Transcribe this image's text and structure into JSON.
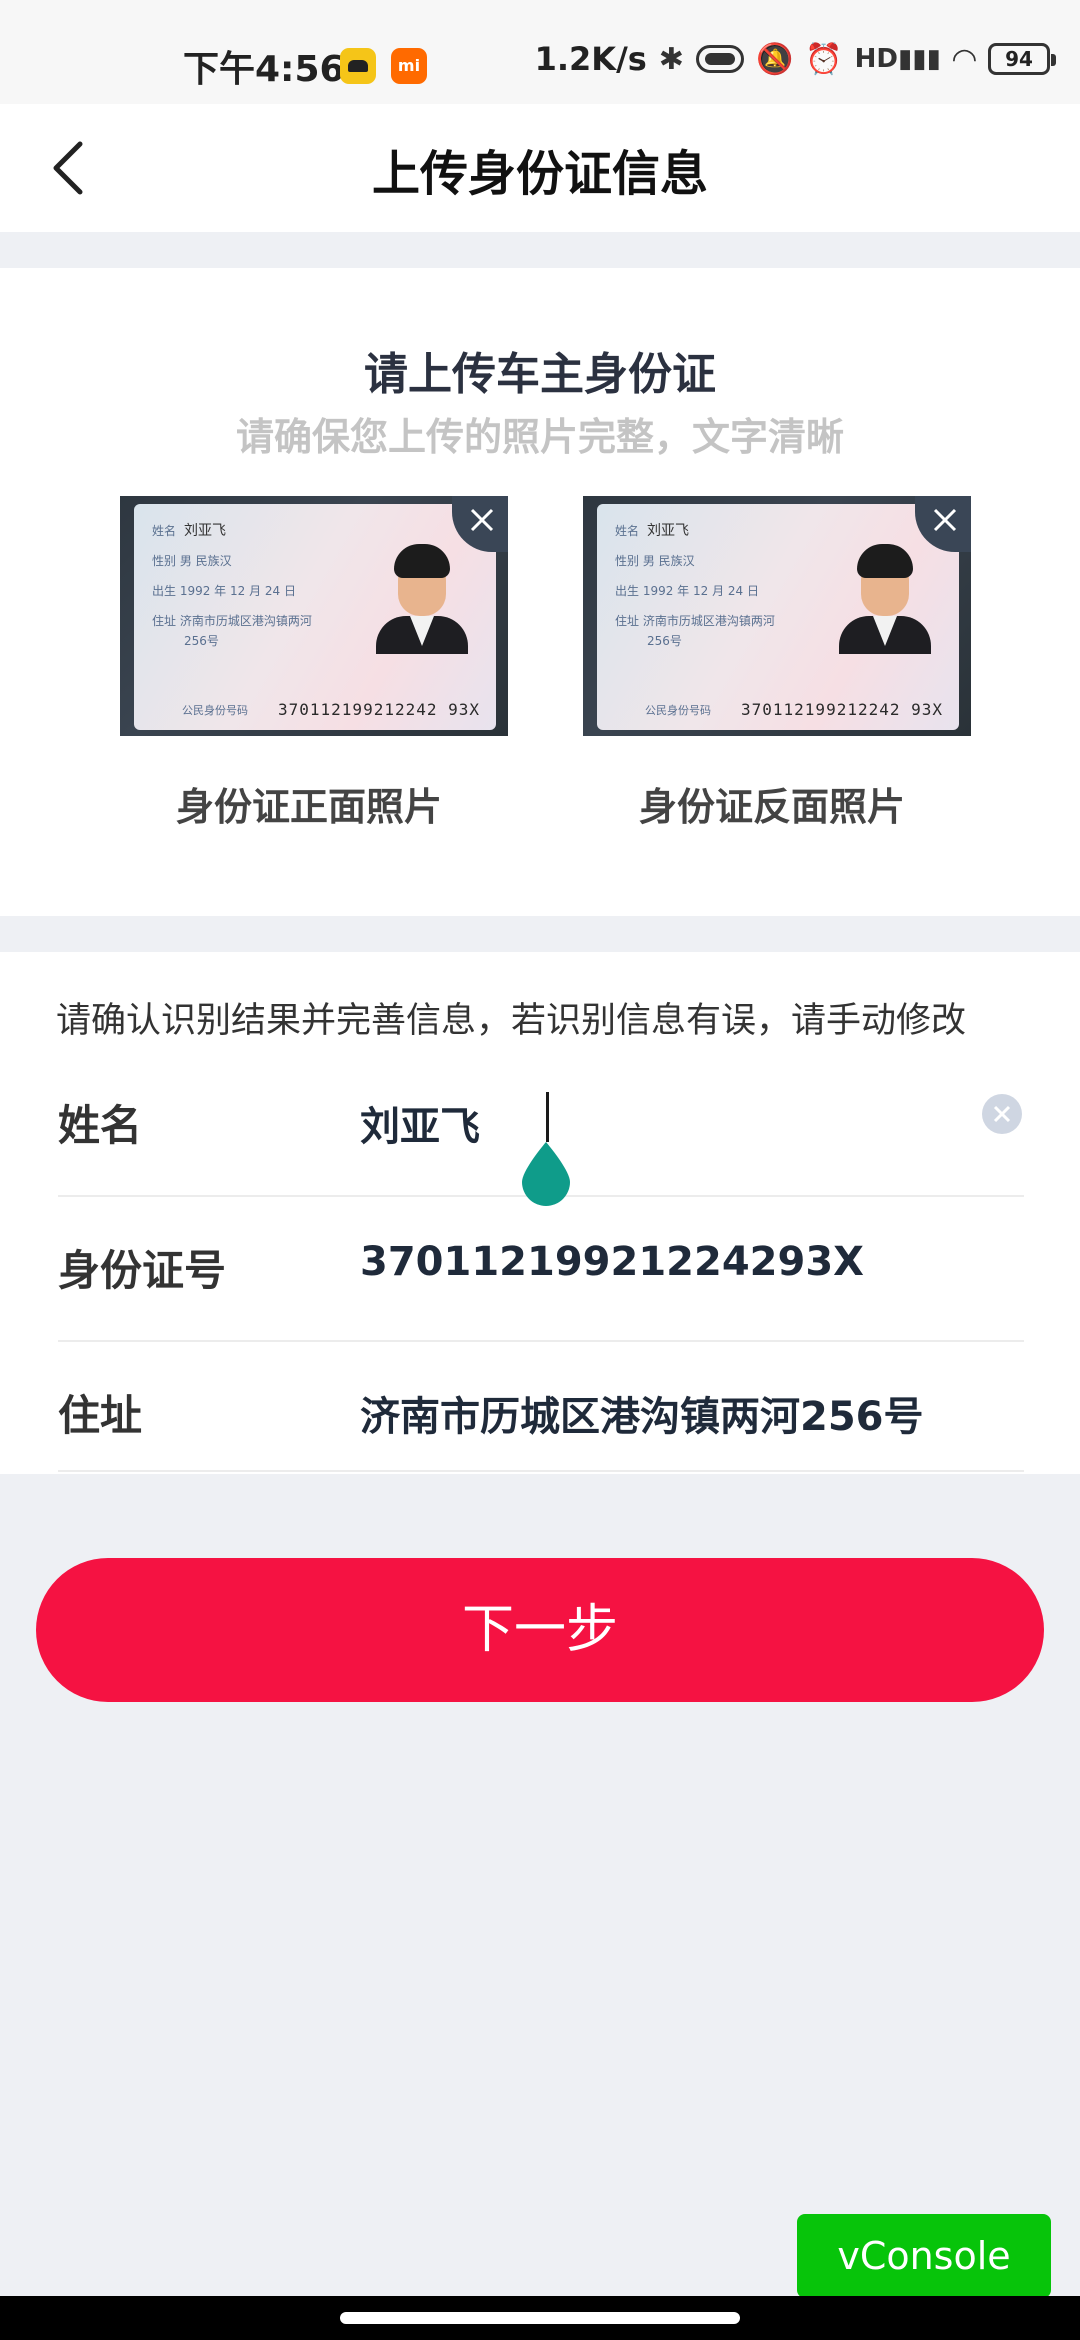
{
  "status_bar": {
    "time": "下午4:56",
    "network_speed": "1.2K/s",
    "battery": "94",
    "icons": [
      "bluetooth-icon",
      "toggle-icon",
      "mute-icon",
      "alarm-icon",
      "hd-signal-icon",
      "wifi-icon",
      "battery-icon"
    ]
  },
  "header": {
    "title": "上传身份证信息",
    "back_icon": "chevron-left-icon"
  },
  "upload": {
    "title": "请上传车主身份证",
    "subtitle": "请确保您上传的照片完整，文字清晰",
    "photos": [
      {
        "label": "身份证正面照片",
        "card_name": "刘亚飞",
        "card_gender_line": "性别  男    民族汉",
        "card_birth_line": "出生  1992 年 12 月 24 日",
        "card_address_line1": "住址  济南市历城区港沟镇两河",
        "card_address_line2": "256号",
        "card_number_label": "公民身份号码",
        "card_number": "370112199212242 93X"
      },
      {
        "label": "身份证反面照片",
        "card_name": "刘亚飞",
        "card_gender_line": "性别  男    民族汉",
        "card_birth_line": "出生  1992 年 12 月 24 日",
        "card_address_line1": "住址  济南市历城区港沟镇两河",
        "card_address_line2": "256号",
        "card_number_label": "公民身份号码",
        "card_number": "370112199212242 93X"
      }
    ]
  },
  "info": {
    "hint": "请确认识别结果并完善信息，若识别信息有误，请手动修改",
    "fields": [
      {
        "label": "姓名",
        "value": "刘亚飞"
      },
      {
        "label": "身份证号",
        "value": "37011219921224293X"
      },
      {
        "label": "住址",
        "value": "济南市历城区港沟镇两河256号"
      }
    ]
  },
  "actions": {
    "next_label": "下一步"
  },
  "vconsole": {
    "label": "vConsole"
  },
  "colors": {
    "primary": "#f51242",
    "vconsole": "#07c40a",
    "handle": "#0f9c8a"
  }
}
